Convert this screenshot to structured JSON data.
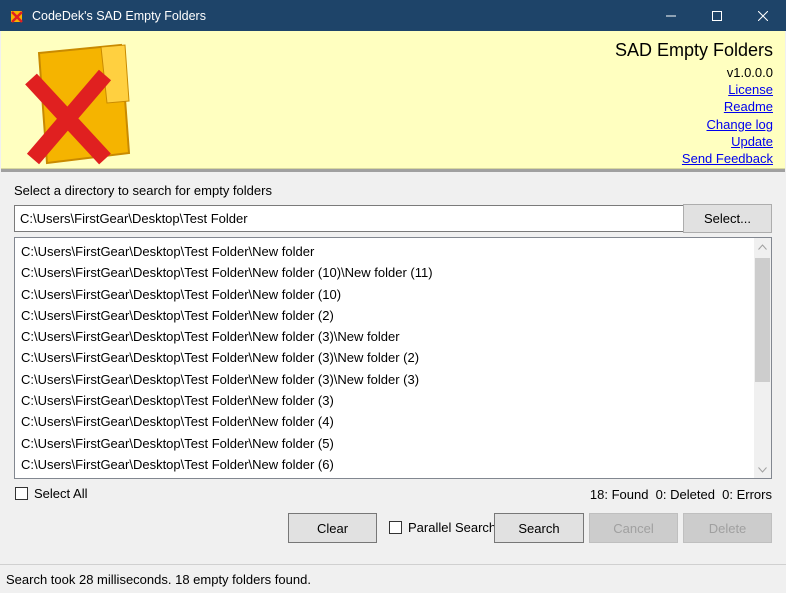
{
  "window": {
    "title": "CodeDek's SAD Empty Folders",
    "minimize": "—",
    "maximize": "☐",
    "close": "✕"
  },
  "header": {
    "app_name": "SAD Empty Folders",
    "version": "v1.0.0.0",
    "links": {
      "license": "License",
      "readme": "Readme",
      "changelog": "Change log",
      "update": "Update",
      "feedback": "Send Feedback"
    }
  },
  "main": {
    "prompt": "Select a directory to search for empty folders",
    "directory_value": "C:\\Users\\FirstGear\\Desktop\\Test Folder",
    "select_button": "Select...",
    "results": [
      "C:\\Users\\FirstGear\\Desktop\\Test Folder\\New folder",
      "C:\\Users\\FirstGear\\Desktop\\Test Folder\\New folder (10)\\New folder (11)",
      "C:\\Users\\FirstGear\\Desktop\\Test Folder\\New folder (10)",
      "C:\\Users\\FirstGear\\Desktop\\Test Folder\\New folder (2)",
      "C:\\Users\\FirstGear\\Desktop\\Test Folder\\New folder (3)\\New folder",
      "C:\\Users\\FirstGear\\Desktop\\Test Folder\\New folder (3)\\New folder (2)",
      "C:\\Users\\FirstGear\\Desktop\\Test Folder\\New folder (3)\\New folder (3)",
      "C:\\Users\\FirstGear\\Desktop\\Test Folder\\New folder (3)",
      "C:\\Users\\FirstGear\\Desktop\\Test Folder\\New folder (4)",
      "C:\\Users\\FirstGear\\Desktop\\Test Folder\\New folder (5)",
      "C:\\Users\\FirstGear\\Desktop\\Test Folder\\New folder (6)"
    ],
    "select_all_label": "Select All",
    "stats": "18: Found  0: Deleted  0: Errors",
    "clear_button": "Clear",
    "parallel_label": "Parallel Search",
    "search_button": "Search",
    "cancel_button": "Cancel",
    "delete_button": "Delete"
  },
  "status": {
    "text": "Search took 28 milliseconds. 18 empty folders found."
  },
  "colors": {
    "titlebar": "#1e4469",
    "header_bg": "#ffffc0",
    "link": "#0000ee",
    "logo_folder": "#f5b400",
    "logo_x": "#e02020"
  }
}
